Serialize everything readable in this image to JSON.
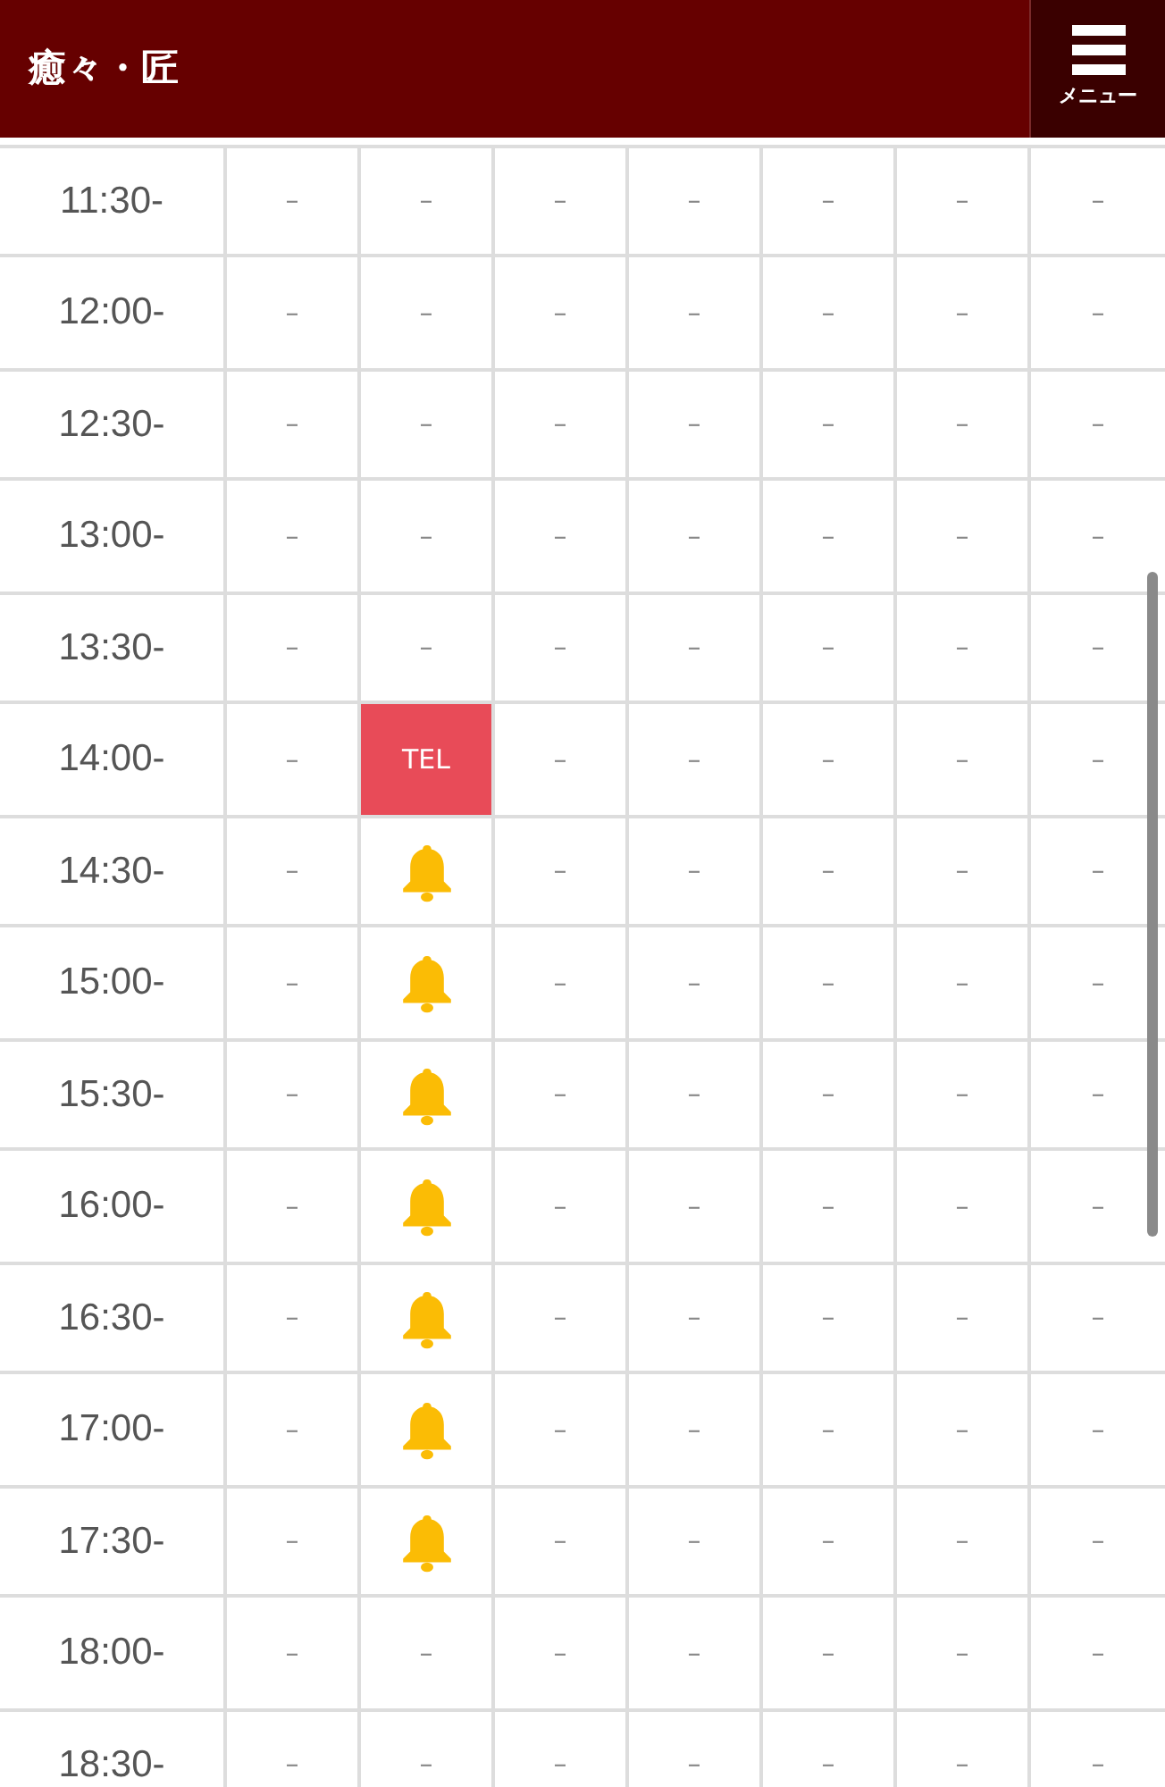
{
  "header": {
    "title": "癒々・匠",
    "menu_label": "メニュー"
  },
  "schedule": {
    "rows": [
      {
        "time": "11:30-",
        "cells": [
          {
            "kind": "dash",
            "text": "–"
          },
          {
            "kind": "dash",
            "text": "–"
          },
          {
            "kind": "dash",
            "text": "–"
          },
          {
            "kind": "dash",
            "text": "–"
          },
          {
            "kind": "dash",
            "text": "–"
          },
          {
            "kind": "dash",
            "text": "–"
          },
          {
            "kind": "dash",
            "text": "–"
          }
        ]
      },
      {
        "time": "12:00-",
        "cells": [
          {
            "kind": "dash",
            "text": "–"
          },
          {
            "kind": "dash",
            "text": "–"
          },
          {
            "kind": "dash",
            "text": "–"
          },
          {
            "kind": "dash",
            "text": "–"
          },
          {
            "kind": "dash",
            "text": "–"
          },
          {
            "kind": "dash",
            "text": "–"
          },
          {
            "kind": "dash",
            "text": "–"
          }
        ]
      },
      {
        "time": "12:30-",
        "cells": [
          {
            "kind": "dash",
            "text": "–"
          },
          {
            "kind": "dash",
            "text": "–"
          },
          {
            "kind": "dash",
            "text": "–"
          },
          {
            "kind": "dash",
            "text": "–"
          },
          {
            "kind": "dash",
            "text": "–"
          },
          {
            "kind": "dash",
            "text": "–"
          },
          {
            "kind": "dash",
            "text": "–"
          }
        ]
      },
      {
        "time": "13:00-",
        "cells": [
          {
            "kind": "dash",
            "text": "–"
          },
          {
            "kind": "dash",
            "text": "–"
          },
          {
            "kind": "dash",
            "text": "–"
          },
          {
            "kind": "dash",
            "text": "–"
          },
          {
            "kind": "dash",
            "text": "–"
          },
          {
            "kind": "dash",
            "text": "–"
          },
          {
            "kind": "dash",
            "text": "–"
          }
        ]
      },
      {
        "time": "13:30-",
        "cells": [
          {
            "kind": "dash",
            "text": "–"
          },
          {
            "kind": "dash",
            "text": "–"
          },
          {
            "kind": "dash",
            "text": "–"
          },
          {
            "kind": "dash",
            "text": "–"
          },
          {
            "kind": "dash",
            "text": "–"
          },
          {
            "kind": "dash",
            "text": "–"
          },
          {
            "kind": "dash",
            "text": "–"
          }
        ]
      },
      {
        "time": "14:00-",
        "cells": [
          {
            "kind": "dash",
            "text": "–"
          },
          {
            "kind": "tel",
            "text": "TEL"
          },
          {
            "kind": "dash",
            "text": "–"
          },
          {
            "kind": "dash",
            "text": "–"
          },
          {
            "kind": "dash",
            "text": "–"
          },
          {
            "kind": "dash",
            "text": "–"
          },
          {
            "kind": "dash",
            "text": "–"
          }
        ]
      },
      {
        "time": "14:30-",
        "cells": [
          {
            "kind": "dash",
            "text": "–"
          },
          {
            "kind": "bell"
          },
          {
            "kind": "dash",
            "text": "–"
          },
          {
            "kind": "dash",
            "text": "–"
          },
          {
            "kind": "dash",
            "text": "–"
          },
          {
            "kind": "dash",
            "text": "–"
          },
          {
            "kind": "dash",
            "text": "–"
          }
        ]
      },
      {
        "time": "15:00-",
        "cells": [
          {
            "kind": "dash",
            "text": "–"
          },
          {
            "kind": "bell"
          },
          {
            "kind": "dash",
            "text": "–"
          },
          {
            "kind": "dash",
            "text": "–"
          },
          {
            "kind": "dash",
            "text": "–"
          },
          {
            "kind": "dash",
            "text": "–"
          },
          {
            "kind": "dash",
            "text": "–"
          }
        ]
      },
      {
        "time": "15:30-",
        "cells": [
          {
            "kind": "dash",
            "text": "–"
          },
          {
            "kind": "bell"
          },
          {
            "kind": "dash",
            "text": "–"
          },
          {
            "kind": "dash",
            "text": "–"
          },
          {
            "kind": "dash",
            "text": "–"
          },
          {
            "kind": "dash",
            "text": "–"
          },
          {
            "kind": "dash",
            "text": "–"
          }
        ]
      },
      {
        "time": "16:00-",
        "cells": [
          {
            "kind": "dash",
            "text": "–"
          },
          {
            "kind": "bell"
          },
          {
            "kind": "dash",
            "text": "–"
          },
          {
            "kind": "dash",
            "text": "–"
          },
          {
            "kind": "dash",
            "text": "–"
          },
          {
            "kind": "dash",
            "text": "–"
          },
          {
            "kind": "dash",
            "text": "–"
          }
        ]
      },
      {
        "time": "16:30-",
        "cells": [
          {
            "kind": "dash",
            "text": "–"
          },
          {
            "kind": "bell"
          },
          {
            "kind": "dash",
            "text": "–"
          },
          {
            "kind": "dash",
            "text": "–"
          },
          {
            "kind": "dash",
            "text": "–"
          },
          {
            "kind": "dash",
            "text": "–"
          },
          {
            "kind": "dash",
            "text": "–"
          }
        ]
      },
      {
        "time": "17:00-",
        "cells": [
          {
            "kind": "dash",
            "text": "–"
          },
          {
            "kind": "bell"
          },
          {
            "kind": "dash",
            "text": "–"
          },
          {
            "kind": "dash",
            "text": "–"
          },
          {
            "kind": "dash",
            "text": "–"
          },
          {
            "kind": "dash",
            "text": "–"
          },
          {
            "kind": "dash",
            "text": "–"
          }
        ]
      },
      {
        "time": "17:30-",
        "cells": [
          {
            "kind": "dash",
            "text": "–"
          },
          {
            "kind": "bell"
          },
          {
            "kind": "dash",
            "text": "–"
          },
          {
            "kind": "dash",
            "text": "–"
          },
          {
            "kind": "dash",
            "text": "–"
          },
          {
            "kind": "dash",
            "text": "–"
          },
          {
            "kind": "dash",
            "text": "–"
          }
        ]
      },
      {
        "time": "18:00-",
        "cells": [
          {
            "kind": "dash",
            "text": "–"
          },
          {
            "kind": "dash",
            "text": "–"
          },
          {
            "kind": "dash",
            "text": "–"
          },
          {
            "kind": "dash",
            "text": "–"
          },
          {
            "kind": "dash",
            "text": "–"
          },
          {
            "kind": "dash",
            "text": "–"
          },
          {
            "kind": "dash",
            "text": "–"
          }
        ]
      },
      {
        "time": "18:30-",
        "cells": [
          {
            "kind": "dash",
            "text": "–"
          },
          {
            "kind": "dash",
            "text": "–"
          },
          {
            "kind": "dash",
            "text": "–"
          },
          {
            "kind": "dash",
            "text": "–"
          },
          {
            "kind": "dash",
            "text": "–"
          },
          {
            "kind": "dash",
            "text": "–"
          },
          {
            "kind": "dash",
            "text": "–"
          }
        ]
      }
    ]
  }
}
